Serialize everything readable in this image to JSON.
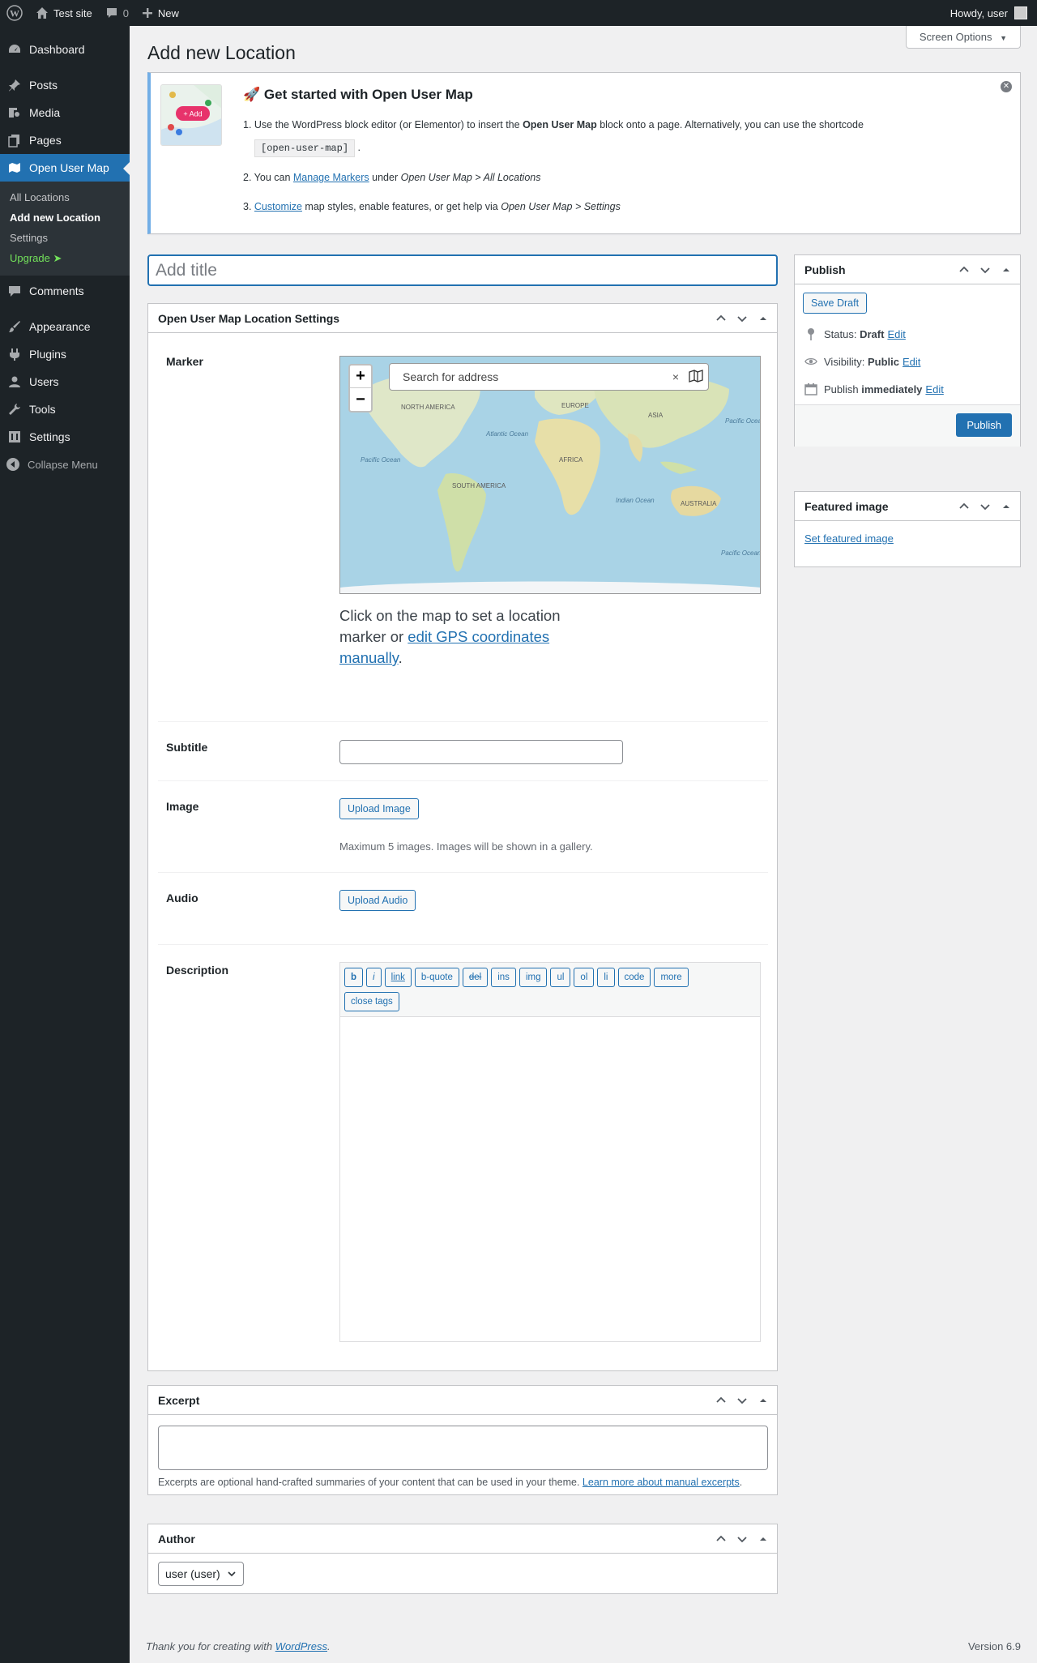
{
  "adminbar": {
    "site_name": "Test site",
    "comments_count": "0",
    "new_label": "New",
    "howdy": "Howdy, user"
  },
  "sidebar": {
    "items": [
      {
        "label": "Dashboard",
        "icon": "dashboard-icon"
      },
      {
        "label": "Posts",
        "icon": "pushpin-icon"
      },
      {
        "label": "Media",
        "icon": "media-icon"
      },
      {
        "label": "Pages",
        "icon": "pages-icon"
      },
      {
        "label": "Open User Map",
        "icon": "map-icon"
      },
      {
        "label": "Comments",
        "icon": "comment-icon"
      },
      {
        "label": "Appearance",
        "icon": "brush-icon"
      },
      {
        "label": "Plugins",
        "icon": "plugin-icon"
      },
      {
        "label": "Users",
        "icon": "user-icon"
      },
      {
        "label": "Tools",
        "icon": "wrench-icon"
      },
      {
        "label": "Settings",
        "icon": "settings-icon"
      }
    ],
    "submenu": [
      "All Locations",
      "Add new Location",
      "Settings",
      "Upgrade ➤"
    ],
    "collapse": "Collapse Menu"
  },
  "page": {
    "title": "Add new Location",
    "screen_options": "Screen Options"
  },
  "notice": {
    "thumb_badge": "+ Add",
    "heading": "🚀 Get started with Open User Map",
    "step1_a": "Use the WordPress block editor (or Elementor) to insert the ",
    "step1_b": "Open User Map",
    "step1_c": " block onto a page. Alternatively, you can use the shortcode",
    "shortcode": "[open-user-map]",
    "step1_d": ".",
    "step2_a": "You can ",
    "step2_link": "Manage Markers",
    "step2_b": " under ",
    "step2_c": "Open User Map > All Locations",
    "step3_link": "Customize",
    "step3_b": " map styles, enable features, or get help via ",
    "step3_c": "Open User Map > Settings"
  },
  "title_input": {
    "placeholder": "Add title"
  },
  "ous_box": {
    "title": "Open User Map Location Settings",
    "marker_label": "Marker",
    "map": {
      "search_placeholder": "Search for address",
      "zoom_in": "+",
      "zoom_out": "−",
      "clear": "×",
      "labels": [
        "NORTH AMERICA",
        "EUROPE",
        "ASIA",
        "Atlantic Ocean",
        "Pacific Ocean",
        "AFRICA",
        "SOUTH AMERICA",
        "Indian Ocean",
        "AUSTRALIA",
        "Pacific Ocean",
        "Pacific Ocean"
      ]
    },
    "marker_help_a": "Click on the map to set a location marker or ",
    "marker_help_link": "edit GPS coordinates manually",
    "marker_help_b": ".",
    "subtitle_label": "Subtitle",
    "image_label": "Image",
    "upload_image": "Upload Image",
    "image_help": "Maximum 5 images. Images will be shown in a gallery.",
    "audio_label": "Audio",
    "upload_audio": "Upload Audio",
    "description_label": "Description",
    "quicktags": [
      "b",
      "i",
      "link",
      "b-quote",
      "del",
      "ins",
      "img",
      "ul",
      "ol",
      "li",
      "code",
      "more",
      "close tags"
    ]
  },
  "publish": {
    "title": "Publish",
    "save_draft": "Save Draft",
    "status_label": "Status:",
    "status_value": "Draft",
    "visibility_label": "Visibility:",
    "visibility_value": "Public",
    "publish_label": "Publish",
    "publish_value": "immediately",
    "edit": "Edit",
    "publish_button": "Publish"
  },
  "featured": {
    "title": "Featured image",
    "link": "Set featured image"
  },
  "excerpt": {
    "title": "Excerpt",
    "help": "Excerpts are optional hand-crafted summaries of your content that can be used in your theme.",
    "help_link": "Learn more about manual excerpts",
    "help_end": "."
  },
  "author": {
    "title": "Author",
    "selected": "user (user)"
  },
  "footer": {
    "thanks": "Thank you for creating with ",
    "wp_link": "WordPress",
    "thanks_end": ".",
    "version": "Version 6.9"
  },
  "colors": {
    "accent": "#2271b1",
    "sidebar": "#1d2327",
    "notice_border": "#72aee6",
    "upgrade": "#72e05a"
  }
}
